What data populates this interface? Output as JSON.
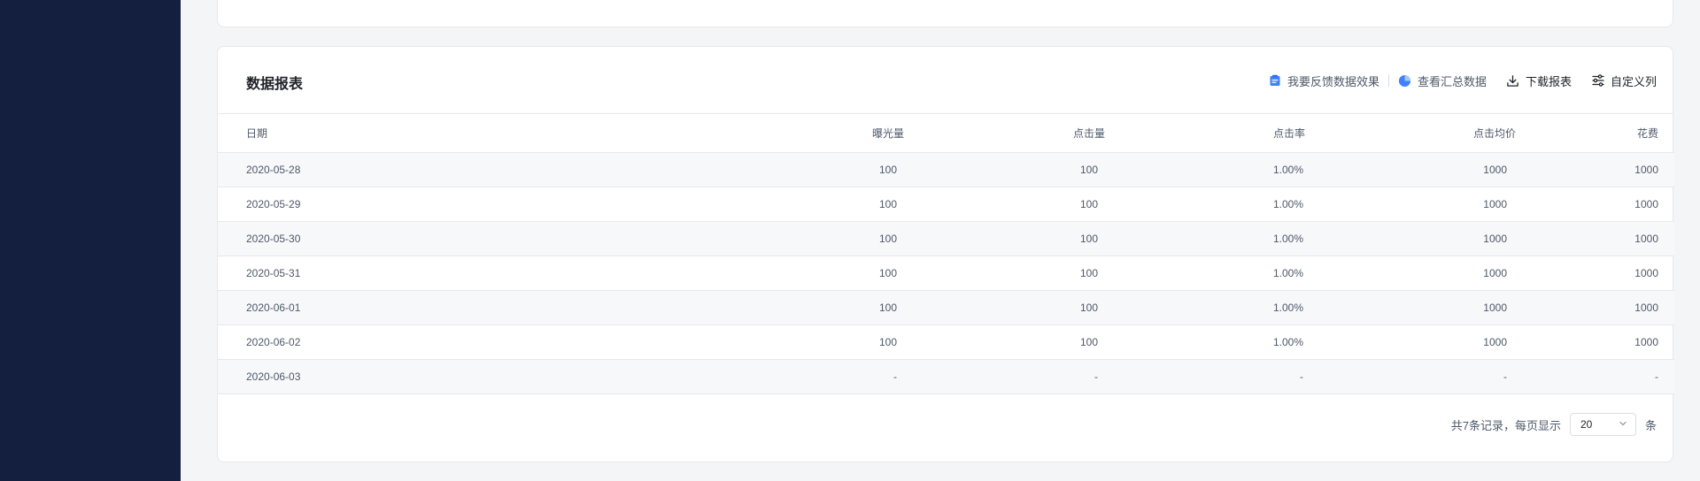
{
  "report": {
    "title": "数据报表",
    "actions": {
      "feedback": "我要反馈数据效果",
      "summary": "查看汇总数据",
      "download": "下载报表",
      "customize": "自定义列"
    },
    "columns": [
      "日期",
      "曝光量",
      "点击量",
      "点击率",
      "点击均价",
      "花费"
    ],
    "rows": [
      [
        "2020-05-28",
        "100",
        "100",
        "1.00%",
        "1000",
        "1000"
      ],
      [
        "2020-05-29",
        "100",
        "100",
        "1.00%",
        "1000",
        "1000"
      ],
      [
        "2020-05-30",
        "100",
        "100",
        "1.00%",
        "1000",
        "1000"
      ],
      [
        "2020-05-31",
        "100",
        "100",
        "1.00%",
        "1000",
        "1000"
      ],
      [
        "2020-06-01",
        "100",
        "100",
        "1.00%",
        "1000",
        "1000"
      ],
      [
        "2020-06-02",
        "100",
        "100",
        "1.00%",
        "1000",
        "1000"
      ],
      [
        "2020-06-03",
        "-",
        "-",
        "-",
        "-",
        "-"
      ]
    ],
    "pagination": {
      "summary": "共7条记录，每页显示",
      "page_size": "20",
      "unit": "条"
    }
  },
  "colors": {
    "sidebar": "#141f40",
    "accent": "#4080ff",
    "background": "#f4f5f7"
  },
  "icons": {
    "feedback": "clipboard-icon",
    "summary": "pie-chart-icon",
    "download": "download-icon",
    "customize": "sliders-icon",
    "select": "chevron-down-icon"
  }
}
